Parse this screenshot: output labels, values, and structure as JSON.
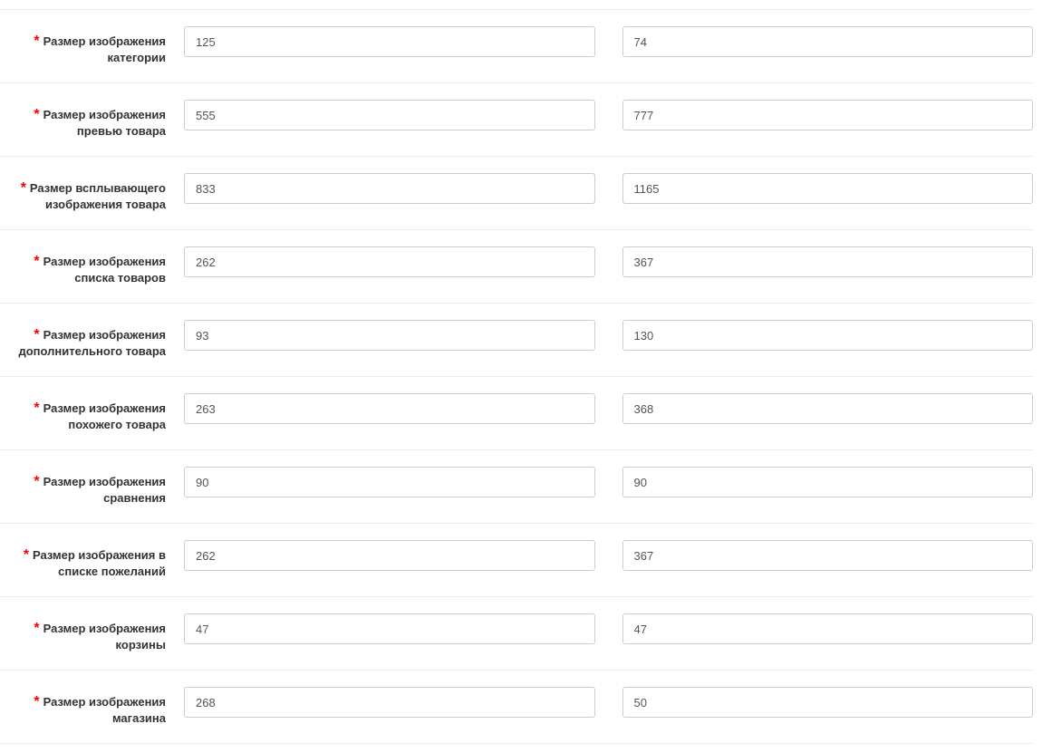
{
  "fields": [
    {
      "label": "Размер изображения категории",
      "name": "category-image-size",
      "value1": "125",
      "value2": "74"
    },
    {
      "label": "Размер изображения превью товара",
      "name": "product-preview-image-size",
      "value1": "555",
      "value2": "777"
    },
    {
      "label": "Размер всплывающего изображения товара",
      "name": "product-popup-image-size",
      "value1": "833",
      "value2": "1165"
    },
    {
      "label": "Размер изображения списка товаров",
      "name": "product-list-image-size",
      "value1": "262",
      "value2": "367"
    },
    {
      "label": "Размер изображения дополнительного товара",
      "name": "additional-product-image-size",
      "value1": "93",
      "value2": "130"
    },
    {
      "label": "Размер изображения похожего товара",
      "name": "related-product-image-size",
      "value1": "263",
      "value2": "368"
    },
    {
      "label": "Размер изображения сравнения",
      "name": "compare-image-size",
      "value1": "90",
      "value2": "90"
    },
    {
      "label": "Размер изображения в списке пожеланий",
      "name": "wishlist-image-size",
      "value1": "262",
      "value2": "367"
    },
    {
      "label": "Размер изображения корзины",
      "name": "cart-image-size",
      "value1": "47",
      "value2": "47"
    },
    {
      "label": "Размер изображения магазина",
      "name": "store-image-size",
      "value1": "268",
      "value2": "50"
    }
  ]
}
